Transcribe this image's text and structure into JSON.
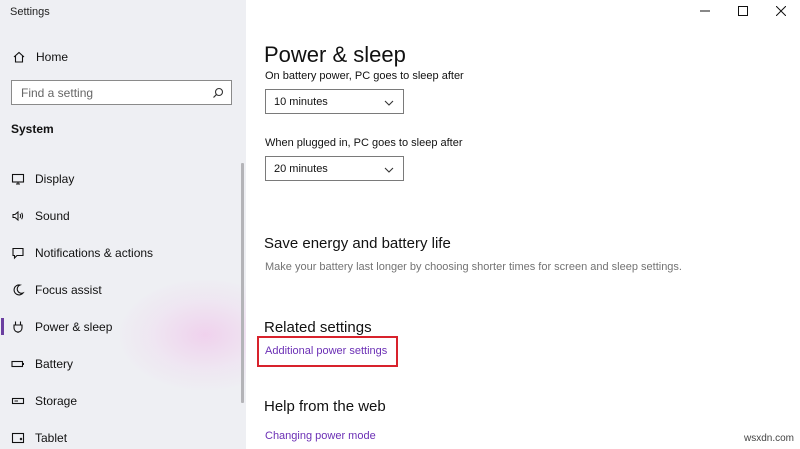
{
  "window": {
    "app_title": "Settings"
  },
  "sidebar": {
    "home_label": "Home",
    "search_placeholder": "Find a setting",
    "section_label": "System",
    "items": [
      {
        "label": "Display",
        "icon": "monitor-icon",
        "active": false
      },
      {
        "label": "Sound",
        "icon": "speaker-icon",
        "active": false
      },
      {
        "label": "Notifications & actions",
        "icon": "notification-icon",
        "active": false
      },
      {
        "label": "Focus assist",
        "icon": "moon-icon",
        "active": false
      },
      {
        "label": "Power & sleep",
        "icon": "power-icon",
        "active": true
      },
      {
        "label": "Battery",
        "icon": "battery-icon",
        "active": false
      },
      {
        "label": "Storage",
        "icon": "storage-icon",
        "active": false
      },
      {
        "label": "Tablet",
        "icon": "tablet-icon",
        "active": false
      }
    ]
  },
  "main": {
    "title": "Power & sleep",
    "battery_sleep_label": "On battery power, PC goes to sleep after",
    "battery_sleep_value": "10 minutes",
    "plugged_sleep_label": "When plugged in, PC goes to sleep after",
    "plugged_sleep_value": "20 minutes",
    "save_energy_heading": "Save energy and battery life",
    "save_energy_desc": "Make your battery last longer by choosing shorter times for screen and sleep settings.",
    "related_heading": "Related settings",
    "related_link": "Additional power settings",
    "help_heading": "Help from the web",
    "help_link": "Changing power mode"
  },
  "watermark": "wsxdn.com",
  "colors": {
    "accent": "#6b3fa0",
    "link": "#6b2fb5",
    "highlight": "#d8222c",
    "sidebar_bg": "#eeeff3"
  }
}
